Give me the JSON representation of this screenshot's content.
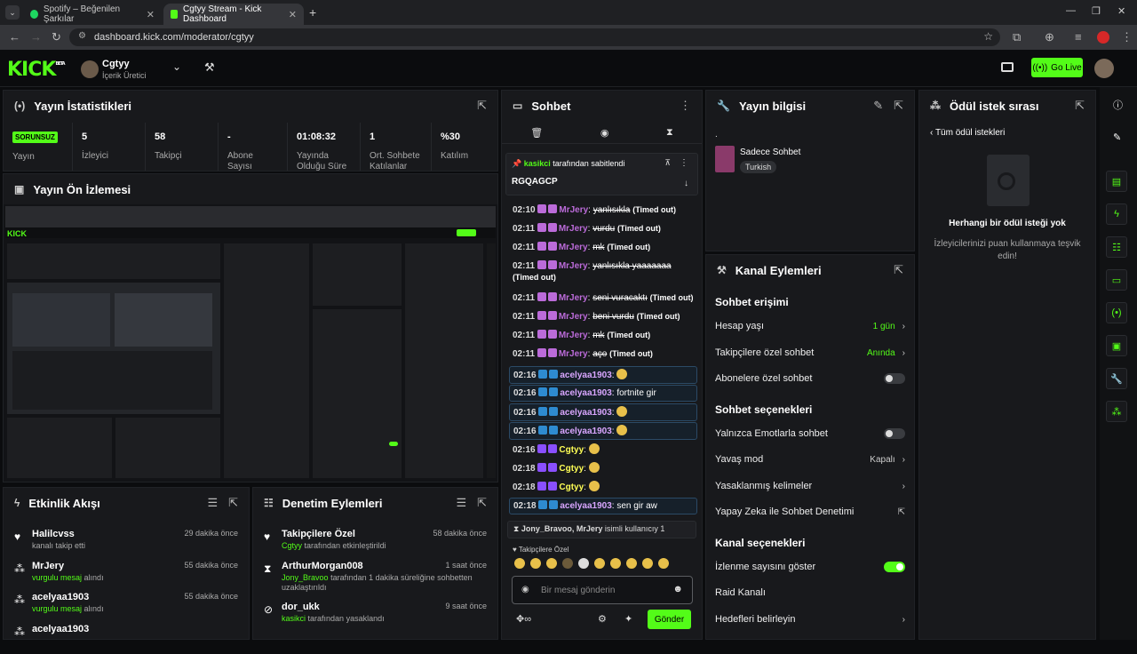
{
  "browser": {
    "tabs": [
      {
        "title": "Spotify – Beğenilen Şarkılar"
      },
      {
        "title": "Cgtyy Stream - Kick Dashboard"
      }
    ],
    "url": "dashboard.kick.com/moderator/cgtyy"
  },
  "header": {
    "logo": "KICK",
    "logo_beta": "BETA",
    "channel_name": "Cgtyy",
    "channel_role": "İçerik Üretici",
    "go_live": "Go Live"
  },
  "stats": {
    "title": "Yayın İstatistikleri",
    "status_badge": "SORUNSUZ",
    "status_label": "Yayın",
    "cells": [
      {
        "value": "5",
        "label": "İzleyici"
      },
      {
        "value": "58",
        "label": "Takipçi"
      },
      {
        "value": "-",
        "label": "Abone Sayısı"
      },
      {
        "value": "01:08:32",
        "label": "Yayında Olduğu Süre"
      },
      {
        "value": "1",
        "label": "Ort. Sohbete Katılanlar"
      },
      {
        "value": "%30",
        "label": "Katılım"
      }
    ]
  },
  "preview": {
    "title": "Yayın Ön İzlemesi"
  },
  "activity": {
    "title": "Etkinlik Akışı",
    "items": [
      {
        "name": "Halilcvss",
        "sub": "kanalı takip etti",
        "time": "29 dakika önce",
        "icon": "heart-icon"
      },
      {
        "name": "MrJery",
        "sub": "vurgulu mesaj",
        "sub2": "alındı",
        "time": "55 dakika önce",
        "icon": "points-icon"
      },
      {
        "name": "acelyaa1903",
        "sub": "vurgulu mesaj",
        "sub2": "alındı",
        "time": "55 dakika önce",
        "icon": "points-icon"
      },
      {
        "name": "acelyaa1903",
        "sub": "",
        "sub2": "",
        "time": "",
        "icon": "points-icon"
      }
    ]
  },
  "moderation": {
    "title": "Denetim Eylemleri",
    "items": [
      {
        "name": "Takipçilere Özel",
        "actor": "Cgtyy",
        "sub": "tarafından etkinleştirildi",
        "time": "58 dakika önce",
        "icon": "heart-icon"
      },
      {
        "name": "ArthurMorgan008",
        "actor": "Jony_Bravoo",
        "sub": "tarafından 1 dakika süreliğine sohbetten uzaklaştırıldı",
        "time": "1 saat önce",
        "icon": "hourglass-icon"
      },
      {
        "name": "dor_ukk",
        "actor": "kasikci",
        "sub": "tarafından yasaklandı",
        "time": "9 saat önce",
        "icon": "ban-icon"
      }
    ]
  },
  "chat": {
    "title": "Sohbet",
    "pinned_by": "kasikci",
    "pinned_text": "tarafından sabitlendi",
    "pinned_msg": "RGQAGCP",
    "messages": [
      {
        "time": "02:10",
        "user": "MrJery",
        "color": "#bb6bd9",
        "text": "yanlısıkla",
        "strike": true,
        "note": "(Timed out)",
        "hl": false
      },
      {
        "time": "02:11",
        "user": "MrJery",
        "color": "#bb6bd9",
        "text": "vurdu",
        "strike": true,
        "note": "(Timed out)",
        "hl": false
      },
      {
        "time": "02:11",
        "user": "MrJery",
        "color": "#bb6bd9",
        "text": "mk",
        "strike": true,
        "note": "(Timed out)",
        "hl": false
      },
      {
        "time": "02:11",
        "user": "MrJery",
        "color": "#bb6bd9",
        "text": "yanlısıkla yaaaaaaa",
        "strike": true,
        "note": "(Timed out)",
        "hl": false
      },
      {
        "time": "02:11",
        "user": "MrJery",
        "color": "#bb6bd9",
        "text": "seni vuracaktı",
        "strike": true,
        "note": "(Timed out)",
        "hl": false
      },
      {
        "time": "02:11",
        "user": "MrJery",
        "color": "#bb6bd9",
        "text": "beni vurdu",
        "strike": true,
        "note": "(Timed out)",
        "hl": false
      },
      {
        "time": "02:11",
        "user": "MrJery",
        "color": "#bb6bd9",
        "text": "mk",
        "strike": true,
        "note": "(Timed out)",
        "hl": false
      },
      {
        "time": "02:11",
        "user": "MrJery",
        "color": "#bb6bd9",
        "text": "aço",
        "strike": true,
        "note": "(Timed out)",
        "hl": false
      },
      {
        "time": "02:16",
        "user": "acelyaa1903",
        "color": "#d9a6ff",
        "text": "",
        "strike": false,
        "note": "",
        "hl": true
      },
      {
        "time": "02:16",
        "user": "acelyaa1903",
        "color": "#d9a6ff",
        "text": "fortnite gir",
        "strike": false,
        "note": "",
        "hl": true
      },
      {
        "time": "02:16",
        "user": "acelyaa1903",
        "color": "#d9a6ff",
        "text": "",
        "strike": false,
        "note": "",
        "hl": true
      },
      {
        "time": "02:16",
        "user": "acelyaa1903",
        "color": "#d9a6ff",
        "text": "",
        "strike": false,
        "note": "",
        "hl": true
      },
      {
        "time": "02:16",
        "user": "Cgtyy",
        "color": "#ffff55",
        "text": "",
        "strike": false,
        "note": "",
        "hl": false
      },
      {
        "time": "02:18",
        "user": "Cgtyy",
        "color": "#ffff55",
        "text": "",
        "strike": false,
        "note": "",
        "hl": false
      },
      {
        "time": "02:18",
        "user": "Cgtyy",
        "color": "#ffff55",
        "text": "",
        "strike": false,
        "note": "",
        "hl": false
      },
      {
        "time": "02:18",
        "user": "acelyaa1903",
        "color": "#d9a6ff",
        "text": "sen gir aw",
        "strike": false,
        "note": "",
        "hl": true
      }
    ],
    "timeout_notice_users": "Jony_Bravoo, MrJery",
    "timeout_notice_text": "isimli kullanıcıy 1",
    "followers_only": "Takipçilere Özel",
    "input_placeholder": "Bir mesaj gönderin",
    "send": "Gönder"
  },
  "stream_info": {
    "title": "Yayın bilgisi",
    "dot": ".",
    "category": "Sadece Sohbet",
    "tag": "Turkish"
  },
  "channel_actions": {
    "title": "Kanal Eylemleri",
    "chat_access": "Sohbet erişimi",
    "account_age": "Hesap yaşı",
    "account_age_val": "1 gün",
    "followers_chat": "Takipçilere özel sohbet",
    "followers_chat_val": "Anında",
    "subs_chat": "Abonelere özel sohbet",
    "chat_options": "Sohbet seçenekleri",
    "emote_only": "Yalnızca Emotlarla sohbet",
    "slow_mode": "Yavaş mod",
    "slow_mode_val": "Kapalı",
    "banned_words": "Yasaklanmış kelimeler",
    "ai_mod": "Yapay Zeka ile Sohbet Denetimi",
    "channel_options": "Kanal seçenekleri",
    "show_views": "İzlenme sayısını göster",
    "raid": "Raid Kanalı",
    "goals": "Hedefleri belirleyin"
  },
  "rewards": {
    "title": "Ödül istek sırası",
    "back": "Tüm ödül istekleri",
    "empty_title": "Herhangi bir ödül isteği yok",
    "empty_desc": "İzleyicilerinizi puan kullanmaya teşvik edin!"
  }
}
